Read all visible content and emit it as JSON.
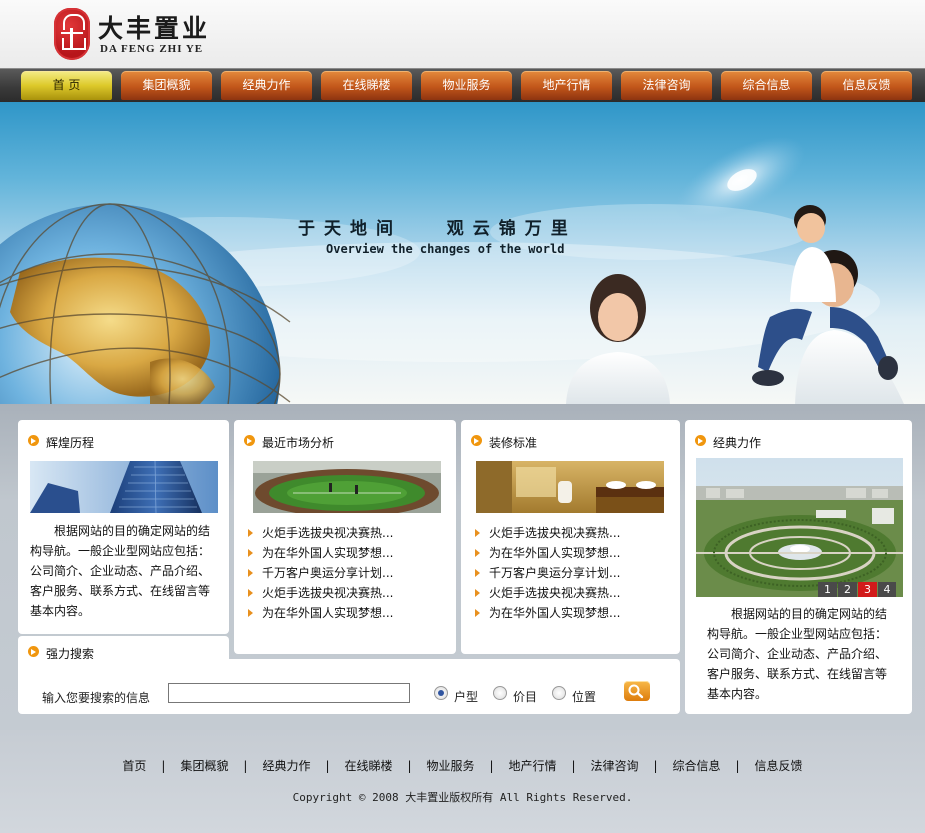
{
  "header": {
    "logo_title": "大丰置业",
    "logo_sub": "DA FENG ZHI YE"
  },
  "nav": {
    "items": [
      "首 页",
      "集团概貌",
      "经典力作",
      "在线睇楼",
      "物业服务",
      "地产行情",
      "法律咨询",
      "综合信息",
      "信息反馈"
    ],
    "active_index": 0
  },
  "banner": {
    "slogan": "于天地间   观云锦万里",
    "subtitle": "Overview the changes of the world"
  },
  "history": {
    "title": "辉煌历程",
    "text": "根据网站的目的确定网站的结构导航。一般企业型网站应包括：公司简介、企业动态、产品介绍、客户服务、联系方式、在线留言等基本内容。"
  },
  "market": {
    "title": "最近市场分析",
    "items": [
      "火炬手选拔央视决赛热...",
      "为在华外国人实现梦想...",
      "千万客户奥运分享计划...",
      "火炬手选拔央视决赛热...",
      "为在华外国人实现梦想..."
    ]
  },
  "decoration": {
    "title": "装修标准",
    "items": [
      "火炬手选拔央视决赛热...",
      "为在华外国人实现梦想...",
      "千万客户奥运分享计划...",
      "火炬手选拔央视决赛热...",
      "为在华外国人实现梦想..."
    ]
  },
  "classic": {
    "title": "经典力作",
    "pager": [
      "1",
      "2",
      "3",
      "4"
    ],
    "pager_active": 2,
    "text": "根据网站的目的确定网站的结构导航。一般企业型网站应包括：公司简介、企业动态、产品介绍、客户服务、联系方式、在线留言等基本内容。"
  },
  "search": {
    "title": "强力搜索",
    "label": "输入您要搜索的信息",
    "value": "",
    "options": [
      "户型",
      "价目",
      "位置"
    ],
    "selected_index": 0
  },
  "footer": {
    "links": [
      "首页",
      "集团概貌",
      "经典力作",
      "在线睇楼",
      "物业服务",
      "地产行情",
      "法律咨询",
      "综合信息",
      "信息反馈"
    ],
    "separator": "|",
    "copyright": "Copyright © 2008 大丰置业版权所有 All Rights Reserved."
  },
  "colors": {
    "nav_orange": "#c2561a",
    "nav_active_yellow": "#ddc92a",
    "bullet_orange": "#f0960e",
    "panel_bg": "#ffffff",
    "content_bg": "#c0c7ce"
  }
}
